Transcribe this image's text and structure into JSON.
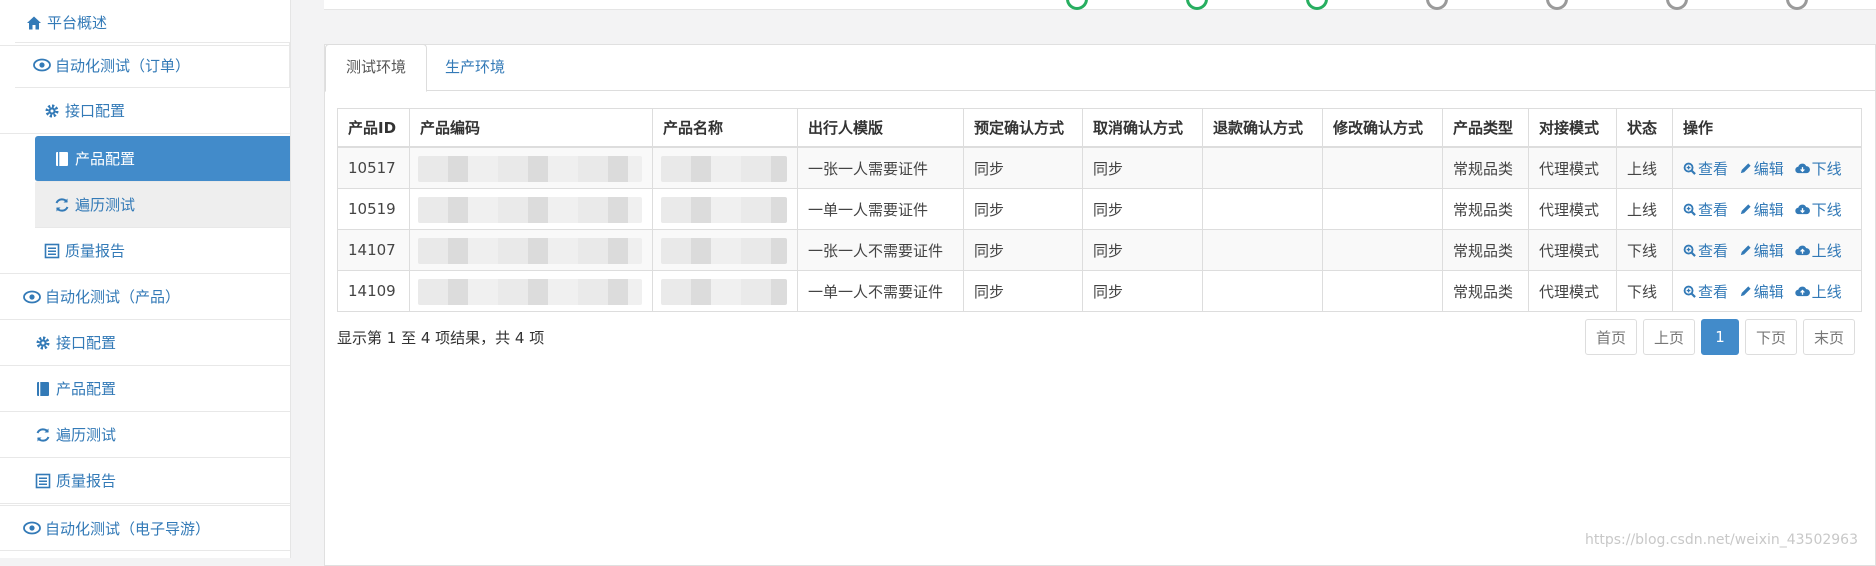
{
  "sidebar": {
    "items": [
      {
        "label": "平台概述",
        "icon": "home-icon"
      },
      {
        "label": "自动化测试（订单）",
        "icon": "eye-icon"
      },
      {
        "label": "接口配置",
        "icon": "gear-icon"
      },
      {
        "label": "产品配置",
        "icon": "book-icon"
      },
      {
        "label": "遍历测试",
        "icon": "refresh-icon"
      },
      {
        "label": "质量报告",
        "icon": "list-icon"
      },
      {
        "label": "自动化测试（产品）",
        "icon": "eye-icon"
      },
      {
        "label": "接口配置",
        "icon": "gear-icon"
      },
      {
        "label": "产品配置",
        "icon": "book-icon"
      },
      {
        "label": "遍历测试",
        "icon": "refresh-icon"
      },
      {
        "label": "质量报告",
        "icon": "list-icon"
      },
      {
        "label": "自动化测试（电子导游）",
        "icon": "eye-icon"
      }
    ]
  },
  "tabs": [
    {
      "label": "测试环境",
      "active": true
    },
    {
      "label": "生产环境",
      "active": false
    }
  ],
  "table": {
    "headers": [
      "产品ID",
      "产品编码",
      "产品名称",
      "出行人模版",
      "预定确认方式",
      "取消确认方式",
      "退款确认方式",
      "修改确认方式",
      "产品类型",
      "对接模式",
      "状态",
      "操作"
    ],
    "rows": [
      {
        "id": "10517",
        "code": "",
        "name": "",
        "template": "一张一人需要证件",
        "book": "同步",
        "cancel": "同步",
        "refund": "",
        "modify": "",
        "type": "常规品类",
        "mode": "代理模式",
        "status": "上线",
        "actions": [
          "查看",
          "编辑",
          "下线"
        ]
      },
      {
        "id": "10519",
        "code": "",
        "name": "",
        "template": "一单一人需要证件",
        "book": "同步",
        "cancel": "同步",
        "refund": "",
        "modify": "",
        "type": "常规品类",
        "mode": "代理模式",
        "status": "上线",
        "actions": [
          "查看",
          "编辑",
          "下线"
        ]
      },
      {
        "id": "14107",
        "code": "",
        "name": "",
        "template": "一张一人不需要证件",
        "book": "同步",
        "cancel": "同步",
        "refund": "",
        "modify": "",
        "type": "常规品类",
        "mode": "代理模式",
        "status": "下线",
        "actions": [
          "查看",
          "编辑",
          "上线"
        ]
      },
      {
        "id": "14109",
        "code": "",
        "name": "",
        "template": "一单一人不需要证件",
        "book": "同步",
        "cancel": "同步",
        "refund": "",
        "modify": "",
        "type": "常规品类",
        "mode": "代理模式",
        "status": "下线",
        "actions": [
          "查看",
          "编辑",
          "上线"
        ]
      }
    ]
  },
  "summary": "显示第 1 至 4 项结果，共 4 项",
  "pagination": {
    "first": "首页",
    "prev": "上页",
    "current": "1",
    "next": "下页",
    "last": "末页"
  },
  "watermark": "https://blog.csdn.net/weixin_43502963",
  "colors": {
    "accent": "#428bca",
    "link": "#337ab7",
    "step_done": "#27ae60",
    "step_pending": "#9a9a9a"
  }
}
